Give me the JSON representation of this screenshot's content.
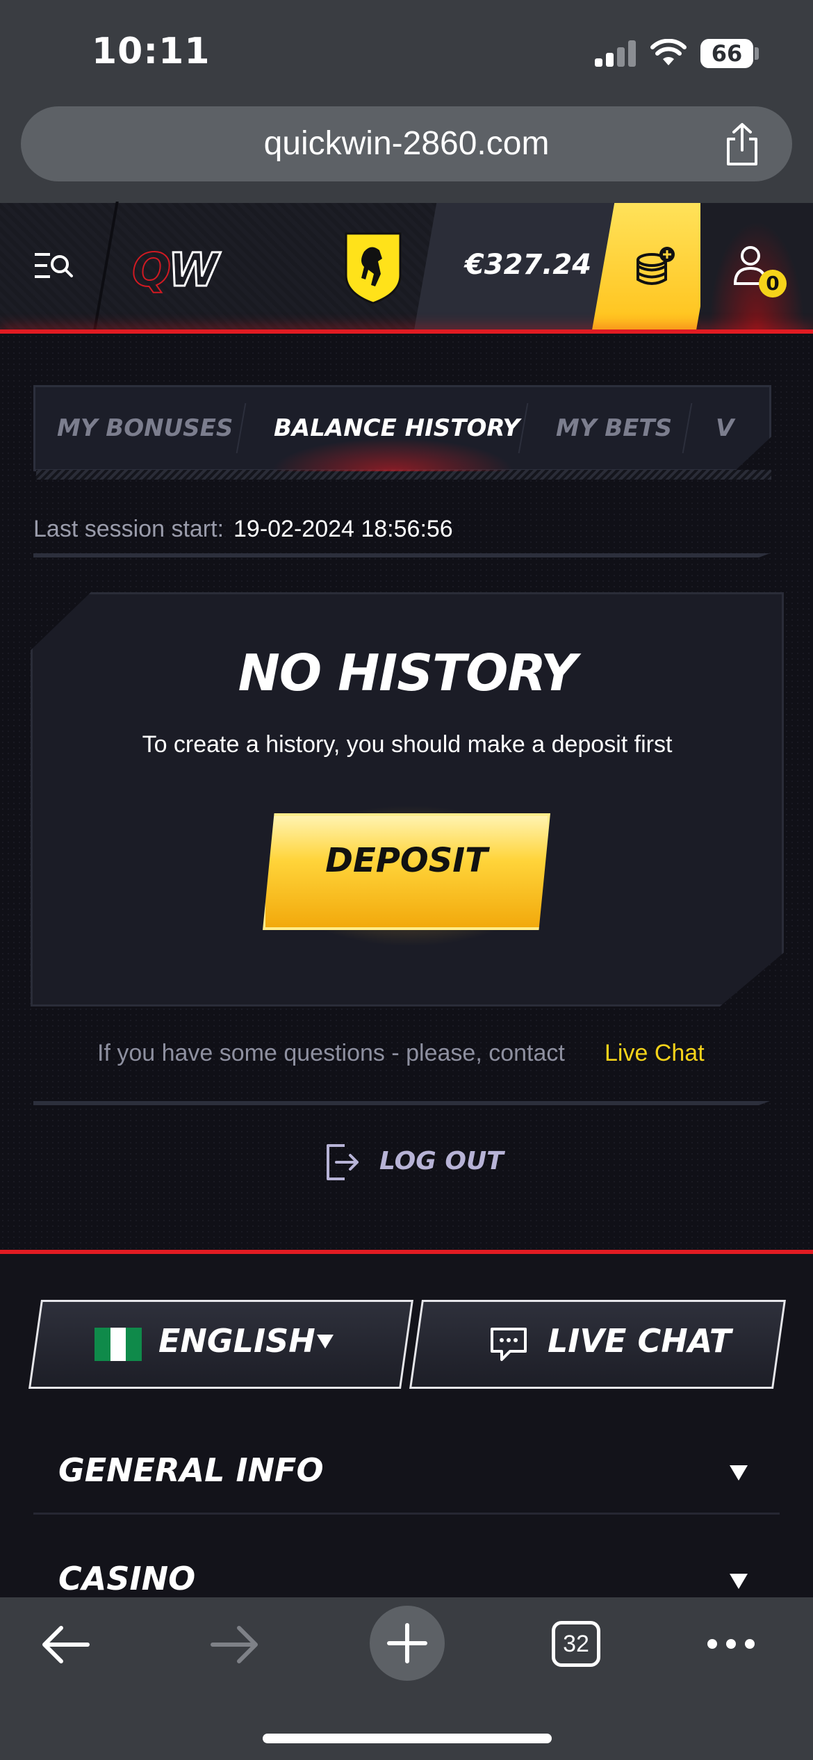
{
  "status_bar": {
    "time": "10:11",
    "battery": "66"
  },
  "browser": {
    "url": "quickwin-2860.com",
    "tab_count": "32"
  },
  "header": {
    "logo": "QW",
    "balance": "€327.24",
    "notifications": "0"
  },
  "tabs": [
    {
      "label": "MY BONUSES",
      "active": false
    },
    {
      "label": "BALANCE HISTORY",
      "active": true
    },
    {
      "label": "MY BETS",
      "active": false
    },
    {
      "label": "V",
      "active": false
    }
  ],
  "session": {
    "label": "Last session start:",
    "value": "19-02-2024 18:56:56"
  },
  "history": {
    "title": "NO HISTORY",
    "subtitle": "To create a history, you should make a deposit first",
    "deposit_label": "DEPOSIT"
  },
  "contact": {
    "text": "If you have some questions - please, contact",
    "link": "Live Chat"
  },
  "logout_label": "LOG OUT",
  "footer": {
    "language": "ENGLISH",
    "live_chat": "LIVE CHAT",
    "sections": [
      "GENERAL INFO",
      "CASINO"
    ]
  },
  "colors": {
    "accent_red": "#e11b22",
    "accent_yellow": "#f5d31a",
    "background": "#101017"
  }
}
